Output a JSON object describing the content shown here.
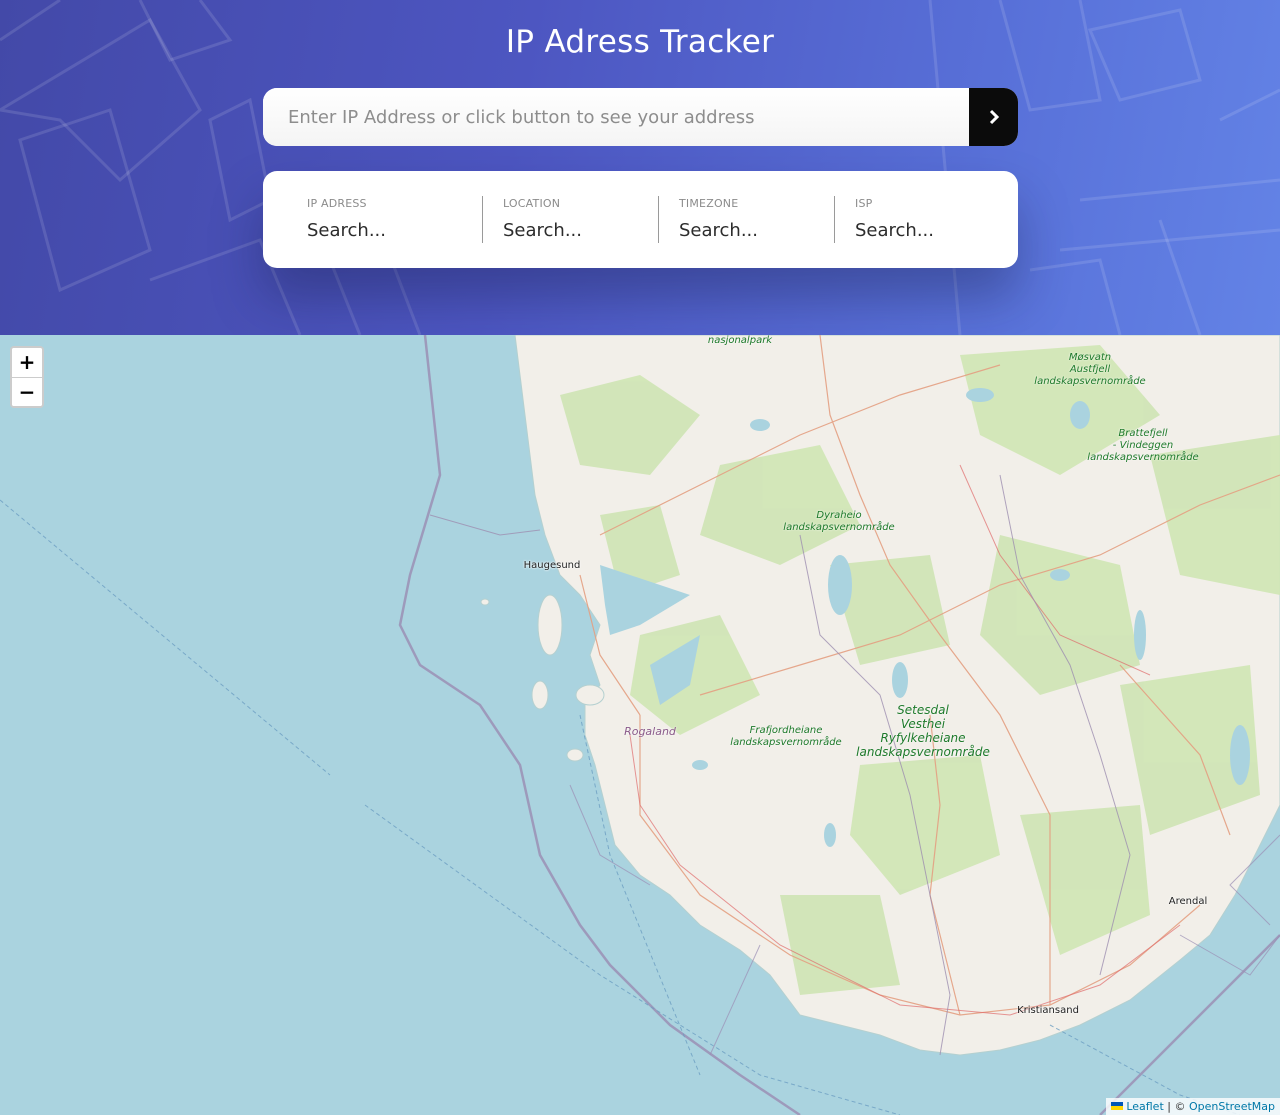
{
  "header": {
    "title": "IP Adress Tracker",
    "gradient": [
      "#4349a8",
      "#6383e6"
    ]
  },
  "search": {
    "placeholder": "Enter IP Address or click button to see your address",
    "button_icon": "chevron-right-icon",
    "value": ""
  },
  "info": {
    "items": [
      {
        "label": "IP ADRESS",
        "value": "Search..."
      },
      {
        "label": "LOCATION",
        "value": "Search..."
      },
      {
        "label": "TIMEZONE",
        "value": "Search..."
      },
      {
        "label": "ISP",
        "value": "Search..."
      }
    ]
  },
  "map": {
    "labels": {
      "nasjonalpark": "nasjonalpark",
      "mosvatn": [
        "Møsvatn",
        "Austfjell",
        "landskapsvernområde"
      ],
      "brattefjell": [
        "Brattefjell",
        "- Vindeggen",
        "landskapsvernområde"
      ],
      "dyraheio": [
        "Dyraheio",
        "landskapsvernområde"
      ],
      "haugesund": "Haugesund",
      "rogaland": "Rogaland",
      "frafjord": [
        "Frafjordheiane",
        "landskapsvernområde"
      ],
      "setesdal": [
        "Setesdal",
        "Vesthei",
        "Ryfylkeheiane",
        "landskapsvernområde"
      ],
      "arendal": "Arendal",
      "kristiansand": "Kristiansand"
    },
    "colors": {
      "water": "#aad3df",
      "land": "#f2efe9",
      "forest": "#cfe5b4",
      "border": "#9e8fb0"
    }
  },
  "zoom": {
    "in": "+",
    "out": "−"
  },
  "attribution": {
    "leaflet": "Leaflet",
    "separator": "| ©",
    "osm": "OpenStreetMap"
  }
}
